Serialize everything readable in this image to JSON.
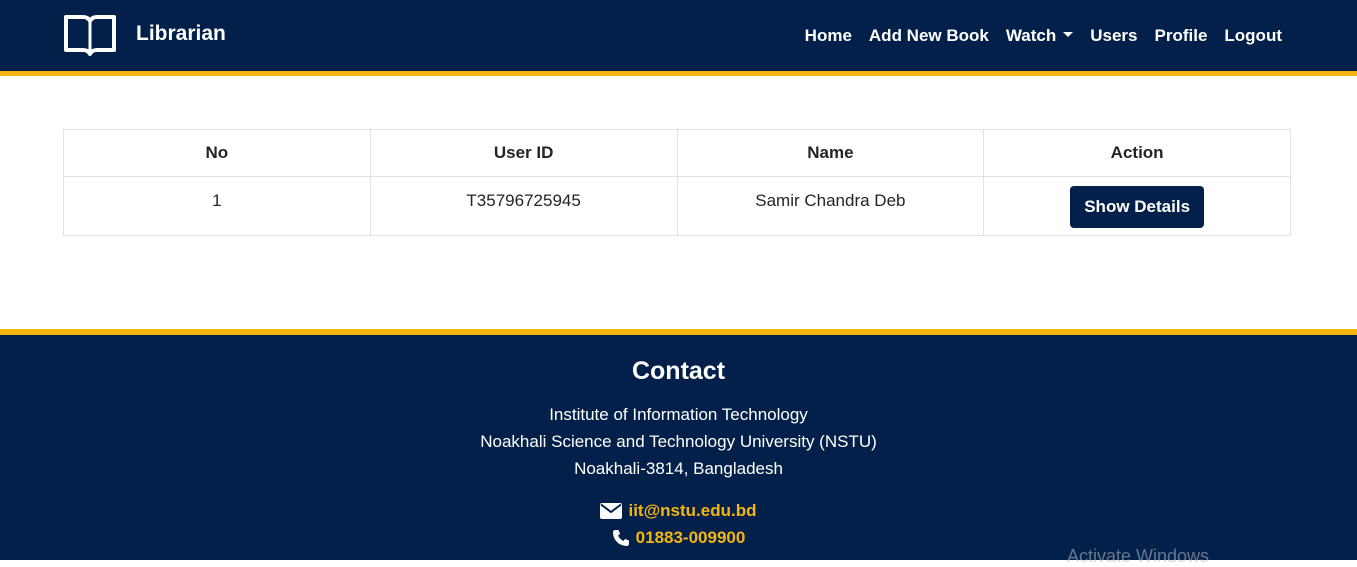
{
  "header": {
    "brand_title": "Librarian",
    "nav": {
      "home": "Home",
      "add_new_book": "Add New Book",
      "watch": "Watch",
      "users": "Users",
      "profile": "Profile",
      "logout": "Logout"
    }
  },
  "table": {
    "columns": [
      "No",
      "User ID",
      "Name",
      "Action"
    ],
    "rows": [
      {
        "no": "1",
        "user_id": "T35796725945",
        "name": "Samir Chandra Deb",
        "action_label": "Show Details"
      }
    ]
  },
  "footer": {
    "title": "Contact",
    "address": [
      "Institute of Information Technology",
      "Noakhali Science and Technology University (NSTU)",
      "Noakhali-3814, Bangladesh"
    ],
    "email": "iit@nstu.edu.bd",
    "phone": "01883-009900"
  },
  "watermark": "Activate Windows",
  "colors": {
    "primary": "#03204a",
    "accent": "#f5b511",
    "text": "#212529",
    "border": "#dee2e6"
  },
  "icons": {
    "brand": "open-book-icon",
    "email": "envelope-icon",
    "phone": "phone-icon",
    "dropdown": "caret-down-icon"
  }
}
